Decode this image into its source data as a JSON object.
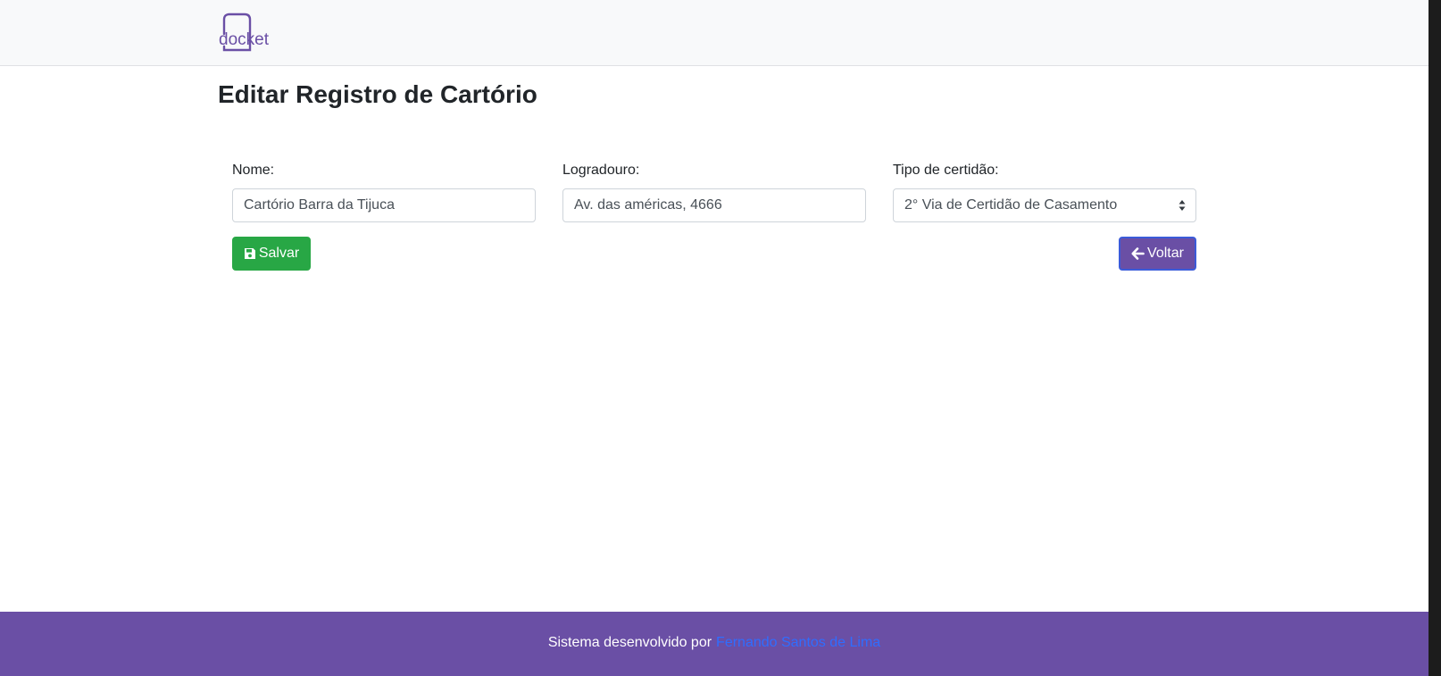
{
  "header": {
    "logo_text": "docket"
  },
  "page": {
    "title": "Editar Registro de Cartório"
  },
  "form": {
    "nome": {
      "label": "Nome:",
      "value": "Cartório Barra da Tijuca"
    },
    "logradouro": {
      "label": "Logradouro:",
      "value": "Av. das américas, 4666"
    },
    "tipo_certidao": {
      "label": "Tipo de certidão:",
      "selected": "2° Via de Certidão de Casamento"
    }
  },
  "buttons": {
    "save_label": "Salvar",
    "save_icon": "save-icon",
    "back_label": "Voltar",
    "back_icon": "arrow-left-icon"
  },
  "footer": {
    "text": "Sistema desenvolvido por",
    "link_text": "Fernando Santos de Lima"
  },
  "colors": {
    "brand_purple": "#6a4fa5",
    "save_green": "#28a745",
    "link_blue": "#2f6dff",
    "navbar_bg": "#f8f9fa"
  }
}
